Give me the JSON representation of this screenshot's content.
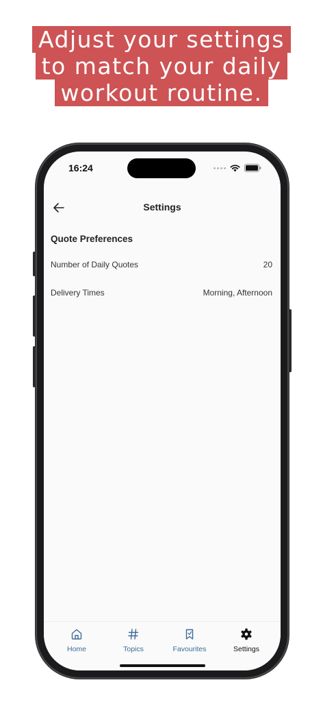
{
  "headline": {
    "lines": [
      "Adjust your settings",
      "to match your daily",
      "workout routine."
    ]
  },
  "status_bar": {
    "time": "16:24"
  },
  "header": {
    "title": "Settings"
  },
  "section": {
    "title": "Quote Preferences",
    "rows": [
      {
        "label": "Number of Daily Quotes",
        "value": "20"
      },
      {
        "label": "Delivery Times",
        "value": "Morning, Afternoon"
      }
    ]
  },
  "tabbar": {
    "items": [
      {
        "label": "Home",
        "icon": "home-icon"
      },
      {
        "label": "Topics",
        "icon": "hashtag-icon"
      },
      {
        "label": "Favourites",
        "icon": "bookmark-icon"
      },
      {
        "label": "Settings",
        "icon": "gear-icon"
      }
    ],
    "active": "Settings"
  },
  "colors": {
    "headline_bg": "#cd5355",
    "tab_inactive": "#3d6a98",
    "tab_active": "#111111"
  }
}
